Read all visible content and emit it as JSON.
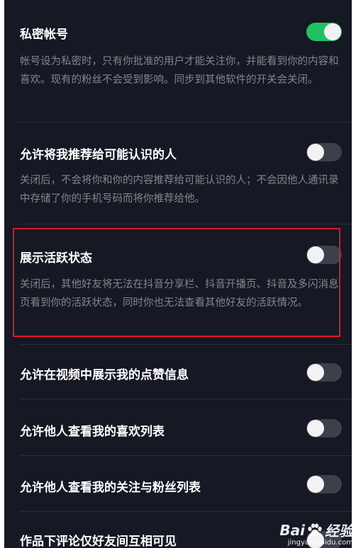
{
  "settings": [
    {
      "title": "私密帐号",
      "description": "帐号设为私密时，只有你批准的用户才能关注你，并能看到你的内容和喜欢。现有的粉丝不会受到影响。同步到其他软件的开关会关闭。",
      "enabled": true
    },
    {
      "title": "允许将我推荐给可能认识的人",
      "description": "关闭后，不会将你和你的内容推荐给可能认识的人；不会因他人通讯录中存储了你的手机号码而将你推荐给他。",
      "enabled": false
    },
    {
      "title": "展示活跃状态",
      "description": "关闭后，其他好友将无法在抖音分享栏、抖音开播页、抖音及多闪消息页看到你的活跃状态，同时你也无法查看其他好友的活跃情况。",
      "enabled": false
    },
    {
      "title": "允许在视频中展示我的点赞信息",
      "enabled": false
    },
    {
      "title": "允许他人查看我的喜欢列表",
      "enabled": false
    },
    {
      "title": "允许他人查看我的关注与粉丝列表",
      "enabled": false
    },
    {
      "title": "作品下评论仅好友间互相可见",
      "enabled": false
    }
  ],
  "watermark": {
    "brand": "Bai",
    "brand_suffix": "经验",
    "url": "jingyan.baidu.com"
  },
  "colors": {
    "background": "#161823",
    "toggle_on": "#20c063",
    "toggle_off": "#3d3f4b",
    "highlight": "#e0142b"
  }
}
